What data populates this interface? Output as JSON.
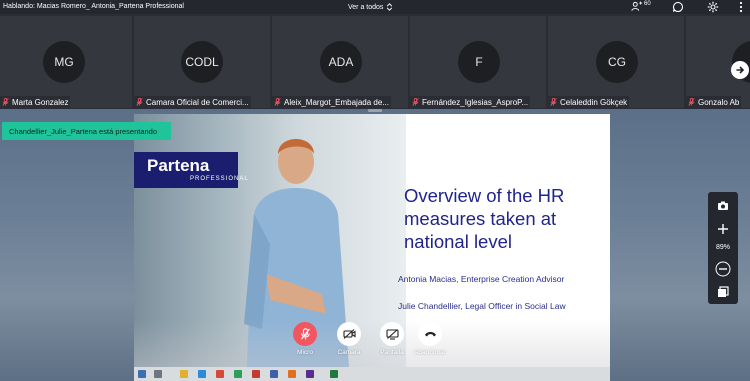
{
  "topbar": {
    "speaking": "Hablando: Macias Romero_ Antonia_Partena Professional",
    "view_all": "Ver a todos",
    "participant_count": "60"
  },
  "tiles": [
    {
      "initials": "MG",
      "name": "Marta Gonzalez"
    },
    {
      "initials": "CODL",
      "name": "Camara Oficial de Comerci..."
    },
    {
      "initials": "ADA",
      "name": "Aleix_Margot_Embajada de..."
    },
    {
      "initials": "F",
      "name": "Fernández_Iglesias_AsproP..."
    },
    {
      "initials": "CG",
      "name": "Celaleddin Gökçek"
    },
    {
      "initials": "",
      "name": "Gonzalo Ab"
    }
  ],
  "presenting_banner": "Chandellier_Julie_Partena está presentando",
  "slide": {
    "logo_brand": "Partena",
    "logo_sub": "PROFESSIONAL",
    "title_lines": [
      "Overview of the HR",
      "measures taken at",
      "national level"
    ],
    "presenter1": "Antonia Macias, Enterprise Creation Advisor",
    "presenter2": "Julie Chandellier, Legal Officer in Social Law"
  },
  "controls": {
    "mic": "Micro",
    "camera": "Cámara",
    "screen": "Pantalla",
    "leave": "Abandonar"
  },
  "zoom": {
    "level": "89%"
  },
  "colors": {
    "accent_green": "#1fc49a",
    "mic_red": "#f25661",
    "slide_title": "#20248c",
    "logo_bg": "#1b1e6e"
  },
  "icons": [
    "chevron-updown-icon",
    "participants-icon",
    "chat-icon",
    "settings-icon",
    "mic-off-icon",
    "camera-off-icon",
    "screen-share-off-icon",
    "leave-call-icon",
    "screenshot-icon",
    "zoom-in-icon",
    "zoom-out-icon",
    "fullscreen-icon",
    "next-arrow-icon"
  ]
}
